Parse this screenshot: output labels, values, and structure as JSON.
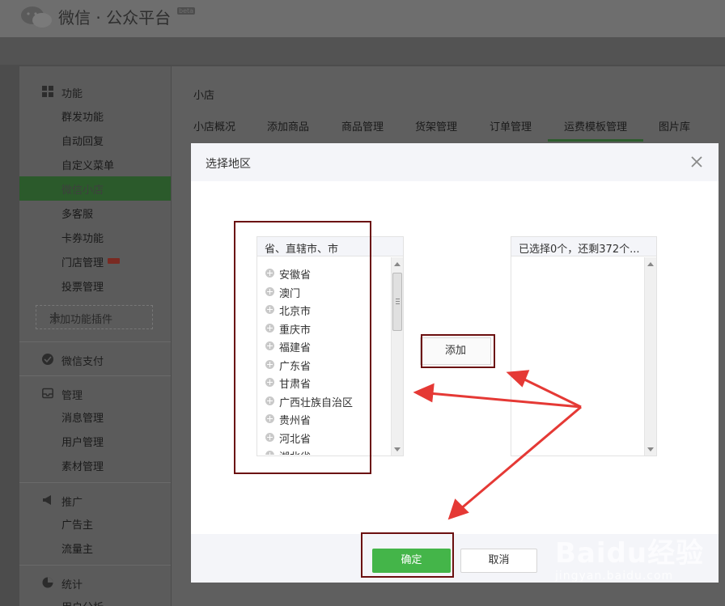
{
  "header": {
    "brand": "微信 · 公众平台",
    "beta": "beta"
  },
  "sidebar": {
    "sections": [
      {
        "title": "功能",
        "items": [
          "群发功能",
          "自动回复",
          "自定义菜单",
          "微信小店",
          "多客服",
          "卡券功能",
          "门店管理",
          "投票管理"
        ]
      },
      {
        "title": "微信支付",
        "items": []
      },
      {
        "title": "管理",
        "items": [
          "消息管理",
          "用户管理",
          "素材管理"
        ]
      },
      {
        "title": "推广",
        "items": [
          "广告主",
          "流量主"
        ]
      },
      {
        "title": "统计",
        "items": [
          "用户分析"
        ]
      }
    ],
    "active_item": "微信小店",
    "add_plugin": "添加功能插件"
  },
  "main": {
    "breadcrumb": "小店",
    "tabs": [
      "小店概况",
      "添加商品",
      "商品管理",
      "货架管理",
      "订单管理",
      "运费模板管理",
      "图片库"
    ],
    "active_tab": "运费模板管理"
  },
  "dialog": {
    "title": "选择地区",
    "left_header": "省、直辖市、市",
    "regions": [
      "安徽省",
      "澳门",
      "北京市",
      "重庆市",
      "福建省",
      "广东省",
      "甘肃省",
      "广西壮族自治区",
      "贵州省",
      "河北省",
      "湖北省"
    ],
    "right_header": "已选择0个，还剩372个...",
    "add_button": "添加",
    "ok_button": "确定",
    "cancel_button": "取消"
  },
  "watermark": {
    "main": "Baidu",
    "cn": "经验",
    "url": "jingyan.baidu.com"
  },
  "colors": {
    "primary": "#44b549",
    "highlight": "#6b1010",
    "arrow": "#e53935"
  }
}
